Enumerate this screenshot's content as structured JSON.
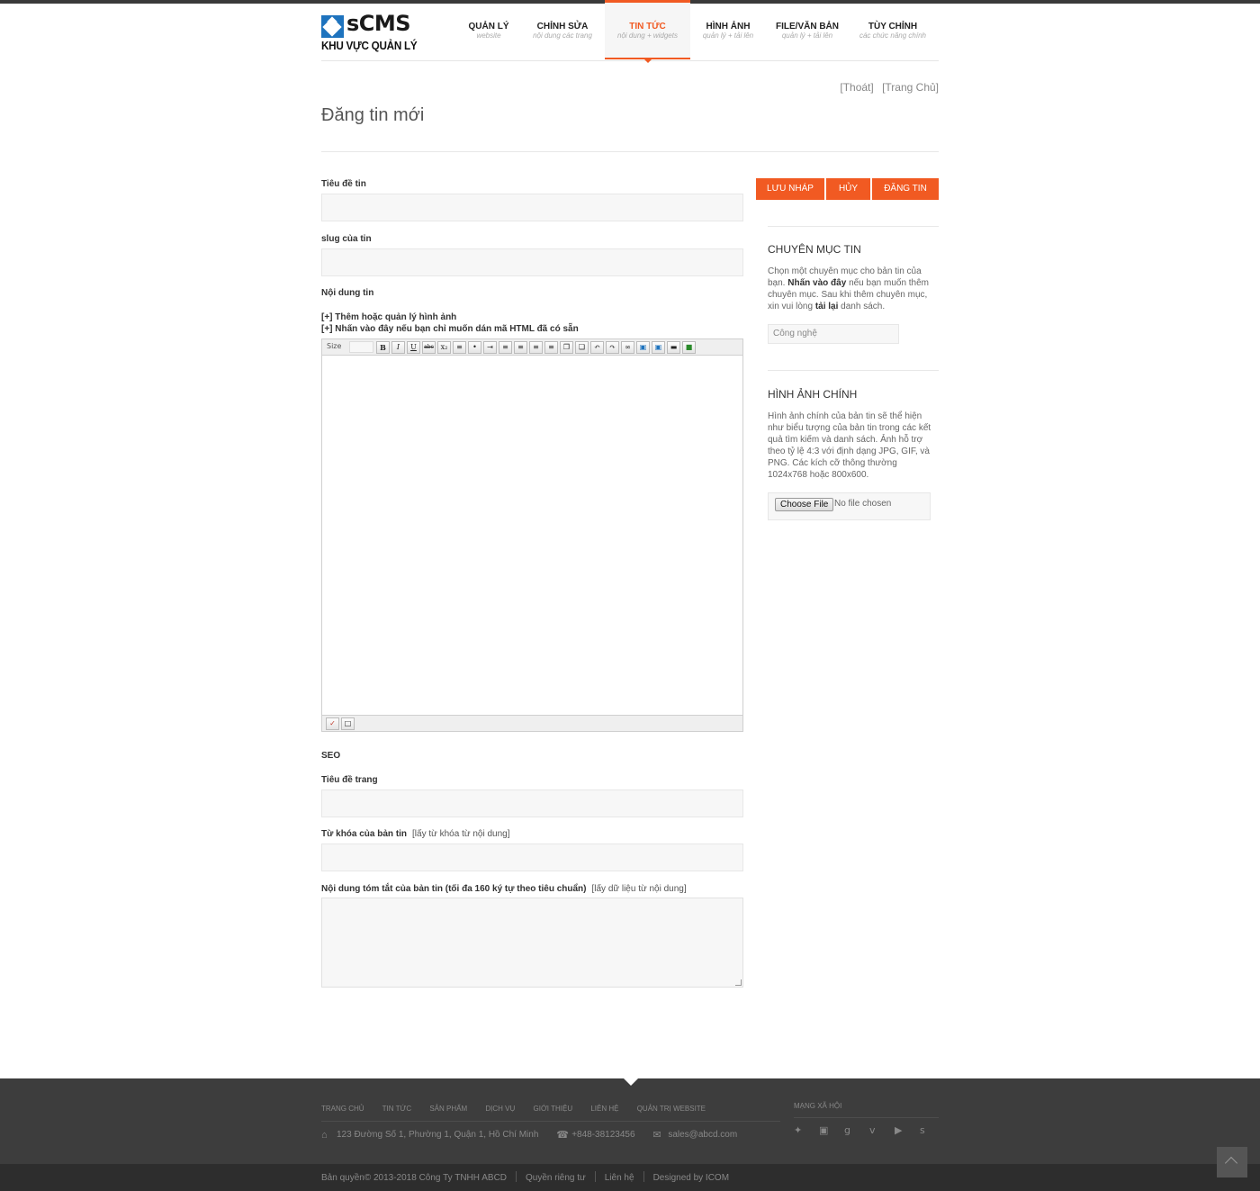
{
  "header": {
    "logo_text": "sCMS",
    "logo_subtitle": "KHU VỰC QUẢN LÝ",
    "nav": [
      {
        "title": "QUẢN LÝ",
        "subtitle": "website"
      },
      {
        "title": "CHỈNH SỬA",
        "subtitle": "nội dung các trang"
      },
      {
        "title": "TIN TỨC",
        "subtitle": "nội dung + widgets"
      },
      {
        "title": "HÌNH ẢNH",
        "subtitle": "quản lý + tải lên"
      },
      {
        "title": "FILE/VĂN BẢN",
        "subtitle": "quản lý + tải lên"
      },
      {
        "title": "TÙY CHỈNH",
        "subtitle": "các chức năng chính"
      }
    ],
    "active_nav": "TIN TỨC"
  },
  "toplinks": {
    "logout": "[Thoát]",
    "home": "[Trang Chủ]"
  },
  "page": {
    "title": "Đăng tin mới"
  },
  "form": {
    "title_label": "Tiêu đề tin",
    "slug_label": "slug của tin",
    "content_label": "Nội dung tin",
    "add_images_link": "[+] Thêm hoặc quản lý hình ảnh",
    "paste_html_link": "[+] Nhấn vào đây nếu bạn chỉ muốn dán mã HTML đã có sẵn",
    "editor": {
      "size_label": "Size",
      "size_value": "",
      "toolbar": [
        "B",
        "I",
        "U",
        "abc",
        "x₂",
        "ol",
        "ul",
        "indent",
        "left",
        "center",
        "right",
        "justify",
        "copy",
        "paste",
        "undo",
        "redo",
        "link",
        "image",
        "unlink",
        "hr",
        "insert"
      ]
    },
    "seo_label": "SEO",
    "page_title_label": "Tiêu đề trang",
    "keywords_label": "Từ khóa của bản tin",
    "keywords_hint": "[lấy từ khóa từ nội dung]",
    "summary_label": "Nội dung tóm tắt của bản tin (tối đa 160 ký tự theo tiêu chuẩn)",
    "summary_hint": "[lấy dữ liệu từ nội dung]"
  },
  "actions": {
    "draft": "LƯU NHÁP",
    "cancel": "HỦY",
    "publish": "ĐĂNG TIN"
  },
  "sidebar": {
    "category": {
      "heading": "CHUYÊN MỤC TIN",
      "text_1": "Chọn một chuyên mục cho bản tin của bạn.",
      "text_bold_1": "Nhấn vào đây",
      "text_2": "nếu bạn muốn thêm chuyên mục. Sau khi thêm chuyên mục, xin vui lòng",
      "text_bold_2": "tải lại",
      "text_3": "danh sách.",
      "selected": "Công nghệ"
    },
    "image": {
      "heading": "HÌNH ẢNH CHÍNH",
      "text": "Hình ảnh chính của bản tin sẽ thể hiện như biểu tượng của bản tin trong các kết quả tìm kiếm và danh sách. Ảnh hỗ trợ theo tỷ lệ 4:3 với định dạng JPG, GIF, và PNG. Các kích cỡ thông thường 1024x768 hoặc 800x600.",
      "file_button": "Choose File",
      "file_status": "No file chosen"
    }
  },
  "footer": {
    "nav": [
      "TRANG CHỦ",
      "TIN TỨC",
      "SẢN PHẨM",
      "DỊCH VỤ",
      "GIỚI THIỆU",
      "LIÊN HỆ",
      "QUẢN TRỊ WEBSITE"
    ],
    "address": "123 Đường Số 1, Phường 1, Quận 1, Hồ Chí Minh",
    "phone": "+848-38123456",
    "email": "sales@abcd.com",
    "social_heading": "MẠNG XÃ HỘI",
    "copyright": "Bản quyền© 2013-2018 Công Ty TNHH ABCD",
    "privacy": "Quyền riêng tư",
    "contact": "Liên hệ",
    "designed_by": "Designed by ICOM"
  }
}
